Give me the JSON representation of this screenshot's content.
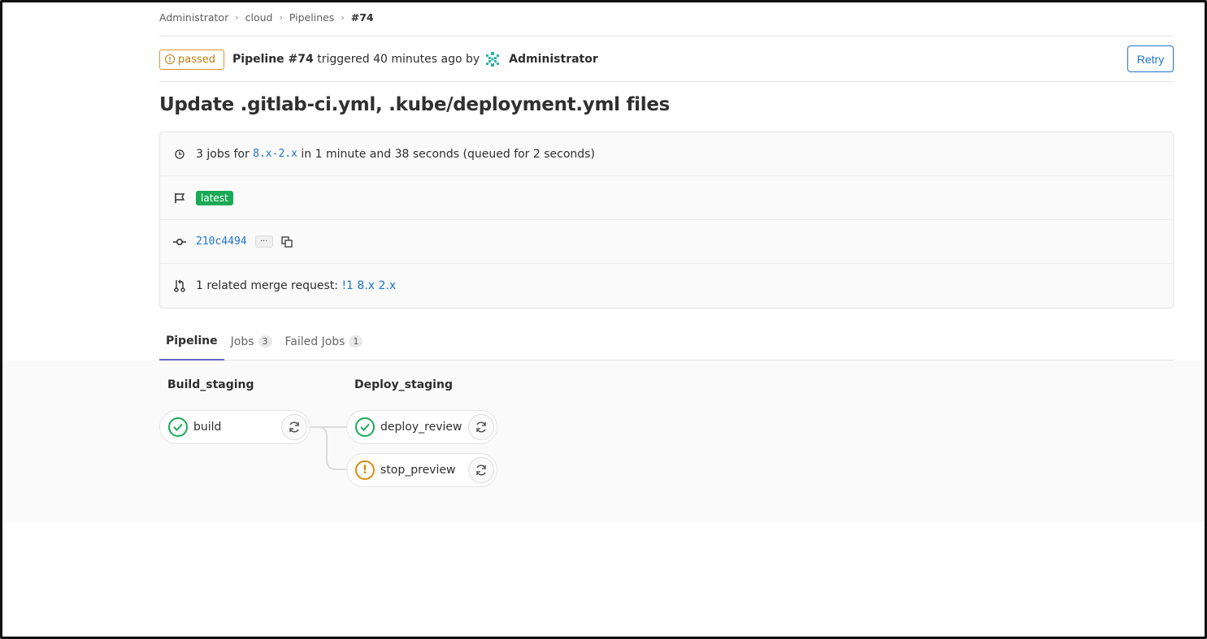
{
  "breadcrumb": {
    "items": [
      "Administrator",
      "cloud",
      "Pipelines"
    ],
    "current": "#74"
  },
  "header": {
    "status": "passed",
    "pipeline_label": "Pipeline #74",
    "triggered_text": "triggered 40 minutes ago by",
    "user": "Administrator",
    "retry_label": "Retry"
  },
  "title": "Update .gitlab-ci.yml, .kube/deployment.yml files",
  "info": {
    "jobs_prefix": "3 jobs for",
    "branch": "8.x-2.x",
    "jobs_suffix": "in 1 minute and 38 seconds (queued for 2 seconds)",
    "tag": "latest",
    "commit": "210c4494",
    "ellipsis": "···",
    "mr_prefix": "1 related merge request:",
    "mr_link": "!1 8.x 2.x"
  },
  "tabs": [
    {
      "label": "Pipeline",
      "count": ""
    },
    {
      "label": "Jobs",
      "count": "3"
    },
    {
      "label": "Failed Jobs",
      "count": "1"
    }
  ],
  "stages": [
    {
      "name": "Build_staging",
      "jobs": [
        {
          "name": "build",
          "status": "success"
        }
      ]
    },
    {
      "name": "Deploy_staging",
      "jobs": [
        {
          "name": "deploy_review",
          "status": "success"
        },
        {
          "name": "stop_preview",
          "status": "warning"
        }
      ]
    }
  ],
  "colors": {
    "accent": "#1f75cb",
    "success": "#1aaa55",
    "warning": "#db8a0a",
    "tab_active": "#6666c4"
  }
}
